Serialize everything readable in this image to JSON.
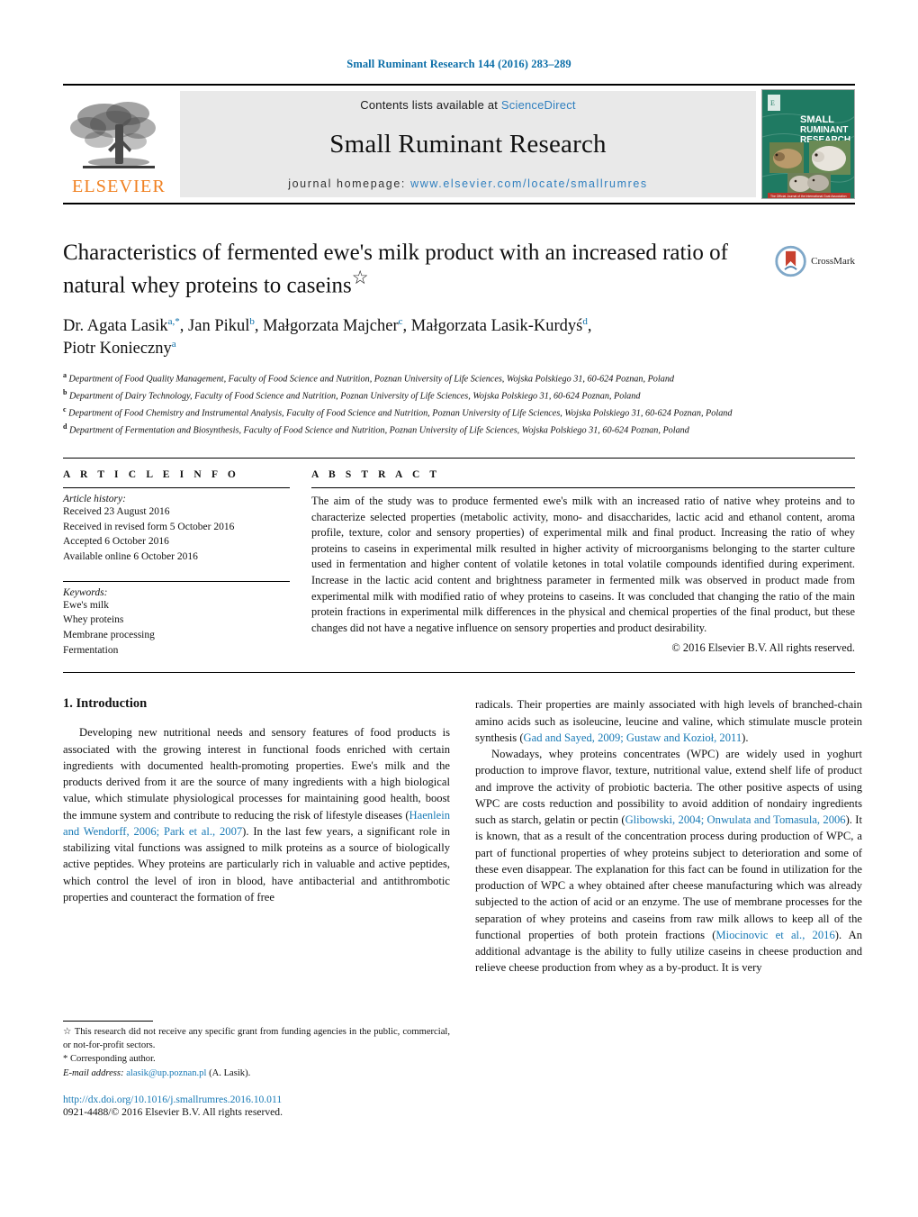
{
  "running_head": "Small Ruminant Research 144 (2016) 283–289",
  "masthead": {
    "publisher_name": "ELSEVIER",
    "contents_prefix": "Contents lists available at ",
    "contents_link": "ScienceDirect",
    "journal_title": "Small Ruminant Research",
    "homepage_prefix": "journal homepage: ",
    "homepage_url": "www.elsevier.com/locate/smallrumres",
    "cover_title_line1": "SMALL",
    "cover_title_line2": "RUMINANT",
    "cover_title_line3": "RESEARCH",
    "cover_footer": "The Official Journal of the International Goat Association"
  },
  "article": {
    "title": "Characteristics of fermented ewe's milk product with an increased ratio of natural whey proteins to caseins",
    "title_marker": "☆",
    "crossmark_label": "CrossMark",
    "authors": [
      {
        "name": "Dr. Agata Lasik",
        "marks": "a,*"
      },
      {
        "name": "Jan Pikul",
        "marks": "b"
      },
      {
        "name": "Małgorzata Majcher",
        "marks": "c"
      },
      {
        "name": "Małgorzata Lasik-Kurdyś",
        "marks": "d"
      },
      {
        "name": "Piotr Konieczny",
        "marks": "a"
      }
    ],
    "affiliations": [
      {
        "mark": "a",
        "text": "Department of Food Quality Management, Faculty of Food Science and Nutrition, Poznan University of Life Sciences, Wojska Polskiego 31, 60-624 Poznan, Poland"
      },
      {
        "mark": "b",
        "text": "Department of Dairy Technology, Faculty of Food Science and Nutrition, Poznan University of Life Sciences, Wojska Polskiego 31, 60-624 Poznan, Poland"
      },
      {
        "mark": "c",
        "text": "Department of Food Chemistry and Instrumental Analysis, Faculty of Food Science and Nutrition, Poznan University of Life Sciences, Wojska Polskiego 31, 60-624 Poznan, Poland"
      },
      {
        "mark": "d",
        "text": "Department of Fermentation and Biosynthesis, Faculty of Food Science and Nutrition, Poznan University of Life Sciences, Wojska Polskiego 31, 60-624 Poznan, Poland"
      }
    ]
  },
  "article_info": {
    "heading": "A R T I C L E    I N F O",
    "history_label": "Article history:",
    "history": [
      "Received 23 August 2016",
      "Received in revised form 5 October 2016",
      "Accepted 6 October 2016",
      "Available online 6 October 2016"
    ],
    "keywords_label": "Keywords:",
    "keywords": [
      "Ewe's milk",
      "Whey proteins",
      "Membrane processing",
      "Fermentation"
    ]
  },
  "abstract": {
    "heading": "A B S T R A C T",
    "text": "The aim of the study was to produce fermented ewe's milk with an increased ratio of native whey proteins and to characterize selected properties (metabolic activity, mono- and disaccharides, lactic acid and ethanol content, aroma profile, texture, color and sensory properties) of experimental milk and final product. Increasing the ratio of whey proteins to caseins in experimental milk resulted in higher activity of microorganisms belonging to the starter culture used in fermentation and higher content of volatile ketones in total volatile compounds identified during experiment. Increase in the lactic acid content and brightness parameter in fermented milk was observed in product made from experimental milk with modified ratio of whey proteins to caseins. It was concluded that changing the ratio of the main protein fractions in experimental milk differences in the physical and chemical properties of the final product, but these changes did not have a negative influence on sensory properties and product desirability.",
    "copyright": "© 2016 Elsevier B.V. All rights reserved."
  },
  "introduction": {
    "section_number_title": "1.  Introduction",
    "left_para_1_a": "Developing new nutritional needs and sensory features of food products is associated with the growing interest in functional foods enriched with certain ingredients with documented health-promoting properties. Ewe's milk and the products derived from it are the source of many ingredients with a high biological value, which stimulate physiological processes for maintaining good health, boost the immune system and contribute to reducing the risk of lifestyle diseases (",
    "left_ref_1": "Haenlein and Wendorff, 2006; Park et al., 2007",
    "left_para_1_b": "). In the last few years, a significant role in stabilizing vital functions was assigned to milk proteins as a source of biologically active peptides. Whey proteins are particularly rich in valuable and active peptides, which control the level of iron in blood, have antibacterial and antithrombotic properties and counteract the formation of free",
    "right_para_1_a": "radicals. Their properties are mainly associated with high levels of branched-chain amino acids such as isoleucine, leucine and valine, which stimulate muscle protein synthesis (",
    "right_ref_1": "Gad and Sayed, 2009; Gustaw and Kozioł, 2011",
    "right_para_1_b": ").",
    "right_para_2_a": "Nowadays, whey proteins concentrates (WPC) are widely used in yoghurt production to improve flavor, texture, nutritional value, extend shelf life of product and improve the activity of probiotic bacteria. The other positive aspects of using WPC are costs reduction and possibility to avoid addition of nondairy ingredients such as starch, gelatin or pectin (",
    "right_ref_2": "Glibowski, 2004; Onwulata and Tomasula, 2006",
    "right_para_2_b": "). It is known, that as a result of the concentration process during production of WPC, a part of functional properties of whey proteins subject to deterioration and some of these even disappear. The explanation for this fact can be found in utilization for the production of WPC a whey obtained after cheese manufacturing which was already subjected to the action of acid or an enzyme. The use of membrane processes for the separation of whey proteins and caseins from raw milk allows to keep all of the functional properties of both protein fractions (",
    "right_ref_3": "Miocinovic et al., 2016",
    "right_para_2_c": "). An additional advantage is the ability to fully utilize caseins in cheese production and relieve cheese production from whey as a by-product. It is very"
  },
  "footnotes": {
    "funding_mark": "☆",
    "funding_text": "This research did not receive any specific grant from funding agencies in the public, commercial, or not-for-profit sectors.",
    "corresponding_mark": "*",
    "corresponding_text": "Corresponding author.",
    "email_label": "E-mail address:",
    "email": "alasik@up.poznan.pl",
    "email_suffix": "(A. Lasik).",
    "doi_url": "http://dx.doi.org/10.1016/j.smallrumres.2016.10.011",
    "issn_line": "0921-4488/© 2016 Elsevier B.V. All rights reserved."
  },
  "colors": {
    "link_blue": "#1779b5",
    "header_blue": "#0b6ea8",
    "elsevier_orange": "#f08020",
    "band_gray": "#e9e9e9",
    "cover_green": "#1f7a62"
  }
}
